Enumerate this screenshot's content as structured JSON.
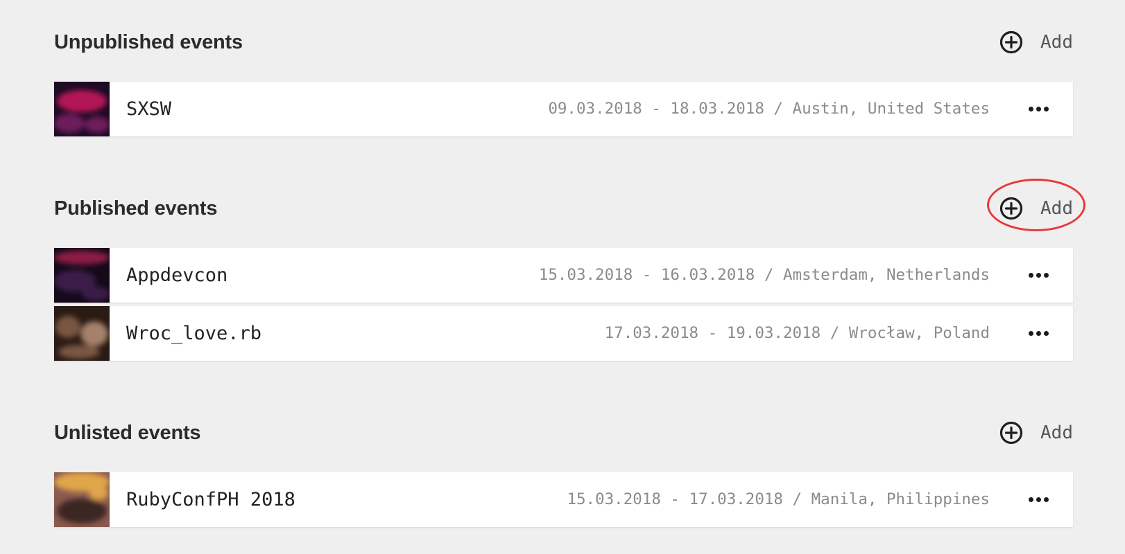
{
  "sections": {
    "unpublished": {
      "title": "Unpublished events",
      "add_label": "Add",
      "events": [
        {
          "name": "SXSW",
          "meta": "09.03.2018 - 18.03.2018 / Austin, United States",
          "thumb": {
            "c1": "#b31856",
            "c2": "#1d0b24",
            "c3": "#6d1b5c"
          }
        }
      ]
    },
    "published": {
      "title": "Published events",
      "add_label": "Add",
      "events": [
        {
          "name": "Appdevcon",
          "meta": "15.03.2018 - 16.03.2018 / Amsterdam, Netherlands",
          "thumb": {
            "c1": "#8b1d44",
            "c2": "#150a1a",
            "c3": "#3b1d4a"
          }
        },
        {
          "name": "Wroc_love.rb",
          "meta": "17.03.2018 - 19.03.2018 / Wrocław, Poland",
          "thumb": {
            "c1": "#7a5642",
            "c2": "#2a1a14",
            "c3": "#a5806a"
          }
        }
      ]
    },
    "unlisted": {
      "title": "Unlisted events",
      "add_label": "Add",
      "events": [
        {
          "name": "RubyConfPH 2018",
          "meta": "15.03.2018 - 17.03.2018 / Manila, Philippines",
          "thumb": {
            "c1": "#e0a64a",
            "c2": "#3a2520",
            "c3": "#8a5a50"
          }
        }
      ]
    }
  },
  "highlight_color": "#e8393a",
  "icons": {
    "add": "plus-circle-icon",
    "menu": "more-horizontal-icon"
  }
}
